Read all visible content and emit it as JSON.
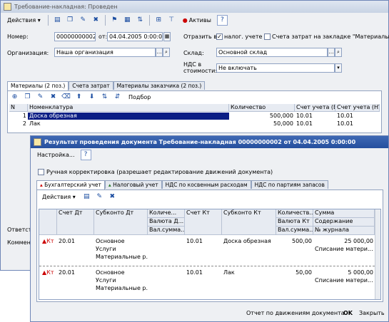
{
  "main_window": {
    "title": "Требование-накладная: Проведен",
    "actions_label": "Действия ▾",
    "active_label": "Активы",
    "help": "?",
    "number_label": "Номер:",
    "number": "00000000002",
    "date_label": "от:",
    "date": "04.04.2005 0:00:0",
    "reflect_label": "Отразить в:",
    "tax_acct_label": "налог. учете",
    "tax_acct_checked": "✓",
    "mat_accounts_label": "Счета затрат на закладке \"Материалы\"",
    "org_label": "Организация:",
    "org_value": "Наша организация",
    "warehouse_label": "Склад:",
    "warehouse_value": "Основной склад",
    "vat_label_1": "НДС в",
    "vat_label_2": "стоимости:",
    "vat_value": "Не включать",
    "tabs": [
      "Материалы (2 поз.)",
      "Счета затрат",
      "Материалы заказчика (2 поз.)"
    ],
    "selection_label": "Подбор",
    "grid_headers": [
      "N",
      "Номенклатура",
      "Количество",
      "Счет учета (БУ)",
      "Счет учета (НУ)"
    ],
    "rows": [
      {
        "n": "1",
        "name": "Доска обрезная",
        "qty": "500,000",
        "bu": "10.01",
        "nu": "10.01"
      },
      {
        "n": "2",
        "name": "Лак",
        "qty": "50,000",
        "bu": "10.01",
        "nu": "10.01"
      }
    ],
    "responsible_label": "Ответст...",
    "comment_label": "Коммен..."
  },
  "result_window": {
    "title": "Результат проведения документа Требование-накладная 00000000002 от 04.04.2005 0:00:00",
    "settings_label": "Настройка...",
    "help": "?",
    "manual_correction_label": "Ручная корректировка (разрешает редактирование движений документа)",
    "tabs": [
      "Бухгалтерский учет",
      "Налоговый учет",
      "НДС по косвенным расходам",
      "НДС по партиям запасов"
    ],
    "actions_label": "Действия ▾",
    "grid_headers": {
      "acct_dt": "Счет Дт",
      "subconto_dt": "Субконто Дт",
      "qty_1": "Количе...",
      "qty_2": "Валюта Д...",
      "qty_3": "Вал.сумма...",
      "acct_kt": "Счет Кт",
      "subconto_kt": "Субконто Кт",
      "qty_kt_1": "Количеств...",
      "qty_kt_2": "Валюта Кт",
      "qty_kt_3": "Вал.сумма...",
      "sum_1": "Сумма",
      "sum_2": "Содержание",
      "sum_3": "№ журнала"
    },
    "rows": [
      {
        "acct_dt": "20.01",
        "sub_dt": [
          "Основное",
          "Услуги",
          "Материальные р..."
        ],
        "acct_kt": "10.01",
        "sub_kt": "Доска обрезная",
        "qty": "500,00",
        "sum": "25 000,00",
        "content": "Списание матери..."
      },
      {
        "acct_dt": "20.01",
        "sub_dt": [
          "Основное",
          "Услуги",
          "Материальные р..."
        ],
        "acct_kt": "10.01",
        "sub_kt": "Лак",
        "qty": "50,00",
        "sum": "5 000,00",
        "content": "Списание матери..."
      }
    ],
    "report_label": "Отчет по движениям документа",
    "ok_label": "OK",
    "close_label": "Закрыть"
  }
}
